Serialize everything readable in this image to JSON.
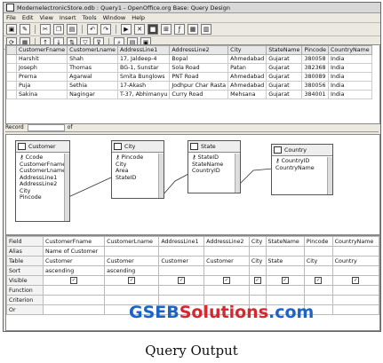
{
  "window": {
    "title": "ModernelectronicStore.odb : Query1 - OpenOffice.org Base: Query Design"
  },
  "menu": [
    "File",
    "Edit",
    "View",
    "Insert",
    "Tools",
    "Window",
    "Help"
  ],
  "result": {
    "columns": [
      "CustomerFname",
      "CustomerLname",
      "AddressLine1",
      "AddressLine2",
      "City",
      "StateName",
      "Pincode",
      "CountryName"
    ],
    "rows": [
      [
        "Harshit",
        "Shah",
        "17, Jaldeep-4",
        "Bopal",
        "Ahmedabad",
        "Gujarat",
        "380058",
        "India"
      ],
      [
        "Joseph",
        "Thomas",
        "BG-1, Sunstar",
        "Sola Road",
        "Patan",
        "Gujarat",
        "382368",
        "India"
      ],
      [
        "Prerna",
        "Agarwal",
        "Smita Bunglows",
        "PNT Road",
        "Ahmedabad",
        "Gujarat",
        "380089",
        "India"
      ],
      [
        "Puja",
        "Sethia",
        "17-Akash",
        "Jodhpur Char Rasta",
        "Ahmedabad",
        "Gujarat",
        "380056",
        "India"
      ],
      [
        "Sakina",
        "Nagingar",
        "T-37, Abhimanyu",
        "Curry Road",
        "Mehsana",
        "Gujarat",
        "384001",
        "India"
      ]
    ]
  },
  "recordbar": {
    "label": "Record",
    "of": "of"
  },
  "tables": {
    "customer": {
      "name": "Customer",
      "fields": [
        "Ccode",
        "CustomerFname",
        "CustomerLname",
        "AddressLine1",
        "AddressLine2",
        "City",
        "Pincode"
      ]
    },
    "city": {
      "name": "City",
      "fields": [
        "Pincode",
        "City",
        "Area",
        "StateID"
      ]
    },
    "state": {
      "name": "State",
      "fields": [
        "StateID",
        "StateName",
        "CountryID"
      ]
    },
    "country": {
      "name": "Country",
      "fields": [
        "CountryID",
        "CountryName"
      ]
    }
  },
  "criteria": {
    "row_labels": [
      "Field",
      "Alias",
      "Table",
      "Sort",
      "Visible",
      "Function",
      "Criterion",
      "Or"
    ],
    "fields": [
      "CustomerFname",
      "CustomerLname",
      "AddressLine1",
      "AddressLine2",
      "City",
      "StateName",
      "Pincode",
      "CountryName"
    ],
    "alias": [
      "Name of Customer",
      "",
      "",
      "",
      "",
      "",
      "",
      ""
    ],
    "tables": [
      "Customer",
      "Customer",
      "Customer",
      "Customer",
      "City",
      "State",
      "City",
      "Country"
    ],
    "sort": [
      "ascending",
      "ascending",
      "",
      "",
      "",
      "",
      "",
      ""
    ],
    "visible_mark": "✓"
  },
  "watermark": {
    "part1": "GSEB",
    "part2": "Solutions",
    "part3": ".com"
  },
  "caption": "Query Output"
}
